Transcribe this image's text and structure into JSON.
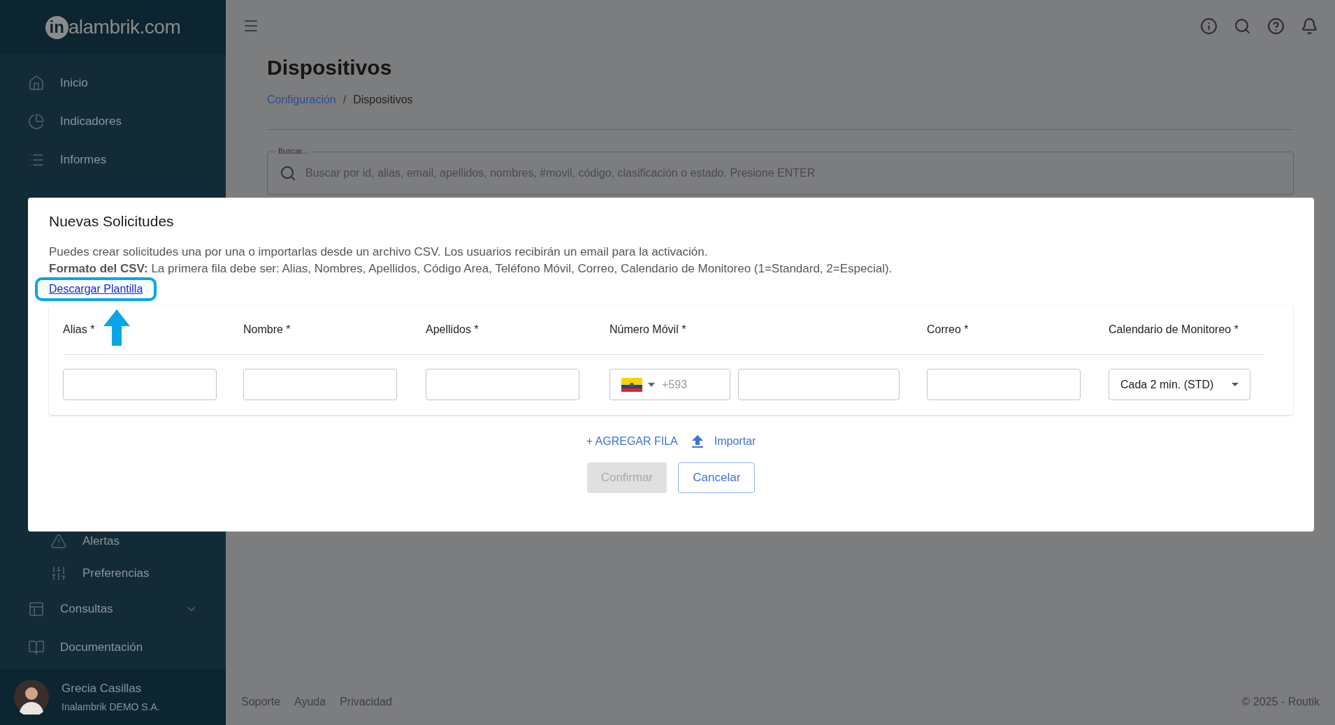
{
  "sidebar": {
    "logo": {
      "mark": "in",
      "name": "alambrik.com"
    },
    "nav_top": [
      {
        "label": "Inicio"
      },
      {
        "label": "Indicadores"
      },
      {
        "label": "Informes"
      }
    ],
    "nav_sub": [
      {
        "label": "Alertas"
      },
      {
        "label": "Preferencias"
      }
    ],
    "nav_bottom": [
      {
        "label": "Consultas",
        "expanded": false
      },
      {
        "label": "Documentación"
      }
    ],
    "user": {
      "name": "Grecia Casillas",
      "org": "Inalambrik DEMO S.A."
    }
  },
  "page": {
    "title": "Dispositivos",
    "breadcrumb_separator": "/",
    "breadcrumb": [
      {
        "label": "Configuración",
        "kind": "link"
      },
      {
        "label": "Dispositivos",
        "kind": "current"
      }
    ],
    "search": {
      "label": "Buscar...",
      "placeholder": "Buscar por id, alias, email, apellidos, nombres, #movil, código, clasificación o estado. Presione ENTER"
    }
  },
  "modal": {
    "title": "Nuevas Solicitudes",
    "description": "Puedes crear solicitudes una por una o importarlas desde un archivo CSV. Los usuarios recibirán un email para la activación.",
    "format": "**Formato del CSV:** La primera fila debe ser: Alias, Nombres, Apellidos, Código Area, Teléfono Móvil, Correo, Calendario de Monitoreo (1=Standard, 2=Especial).",
    "template_link": "Descargar Plantilla",
    "columns": [
      {
        "label": "Alias *",
        "kind": "text"
      },
      {
        "label": "Nombre *",
        "kind": "text"
      },
      {
        "label": "Apellidos *",
        "kind": "text"
      },
      {
        "label": "Número Móvil *",
        "kind": "phone"
      },
      {
        "label": "Correo *",
        "kind": "text"
      },
      {
        "label": "Calendario de Monitoreo *",
        "kind": "select"
      }
    ],
    "row": {
      "phone_code_placeholder": "+593",
      "calendar_value": "Cada 2 min. (STD)"
    },
    "add_row": "+ AGREGAR FILA",
    "import": "Importar",
    "buttons": [
      {
        "label": "Confirmar",
        "disabled": true
      },
      {
        "label": "Cancelar",
        "disabled": false
      }
    ]
  },
  "footer": {
    "links": [
      "Soporte",
      "Ayuda",
      "Privacidad"
    ],
    "copyright": "© 2025 - Routik"
  }
}
